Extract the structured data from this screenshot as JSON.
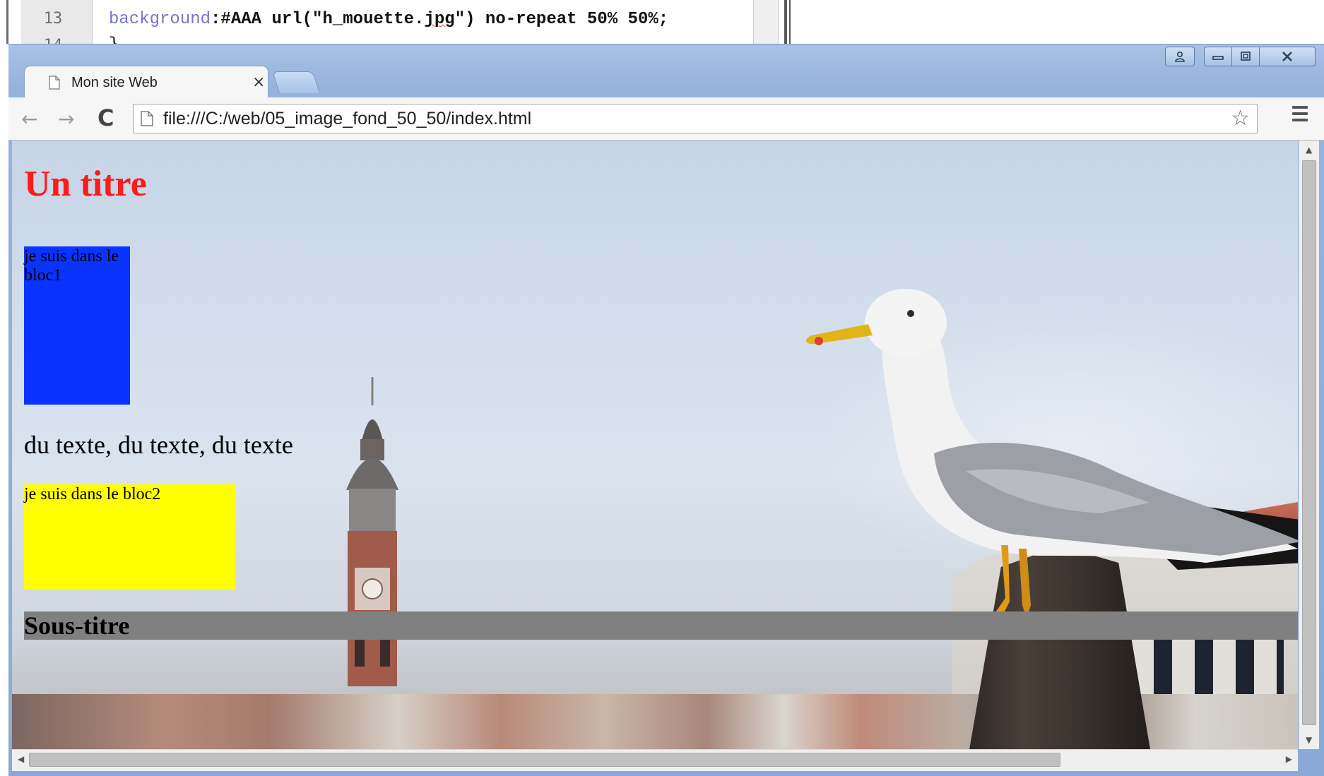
{
  "editor": {
    "line_number": "13",
    "next_line_number": "14",
    "code_property": "background",
    "code_rest_a": ":#AAA url(\"h_mouette.",
    "code_ext": "jpg",
    "code_rest_b": "\") no-repeat 50% 50%;",
    "next_line_code": "}"
  },
  "browser": {
    "window_controls": {
      "profile_icon": "person-icon",
      "minimize_icon": "minimize-icon",
      "maximize_icon": "maximize-icon",
      "close_icon": "close-icon"
    },
    "tab": {
      "title": "Mon site Web",
      "close_glyph": "×"
    },
    "toolbar": {
      "back_glyph": "←",
      "forward_glyph": "→",
      "reload_glyph": "C",
      "url": "file:///C:/web/05_image_fond_50_50/index.html",
      "star_glyph": "☆"
    }
  },
  "page": {
    "h1": "Un titre",
    "bloc1": "je suis dans le bloc1",
    "paragraph": "du texte, du texte, du texte",
    "bloc2": "je suis dans le bloc2",
    "h2": "Sous-titre"
  },
  "colors": {
    "h1": "#ff1a1a",
    "bloc1_bg": "#0b33ff",
    "bloc2_bg": "#ffff00",
    "h2_bg": "#808080"
  }
}
